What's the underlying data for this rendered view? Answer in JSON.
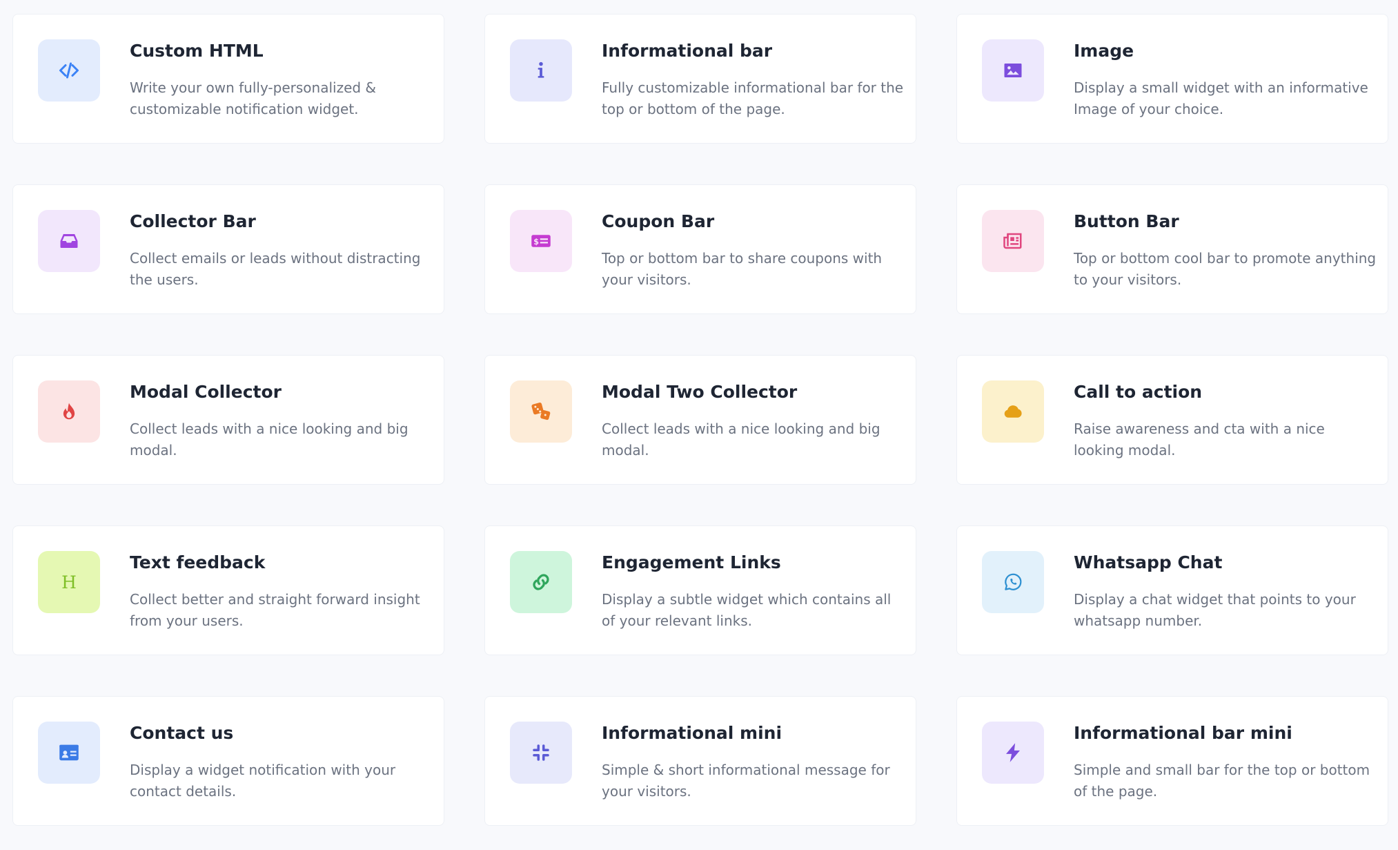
{
  "widgets": [
    {
      "title": "Custom HTML",
      "description": "Write your own fully-personalized & customizable notification widget.",
      "icon": "code-icon",
      "bg": "#e3ecfd",
      "color": "#3b82f6"
    },
    {
      "title": "Informational bar",
      "description": "Fully customizable informational bar for the top or bottom of the page.",
      "icon": "info-icon",
      "bg": "#e6e8fc",
      "color": "#5b5bd6"
    },
    {
      "title": "Image",
      "description": "Display a small widget with an informative Image of your choice.",
      "icon": "image-icon",
      "bg": "#ede8fd",
      "color": "#7c4ddd"
    },
    {
      "title": "Collector Bar",
      "description": "Collect emails or leads without distracting the users.",
      "icon": "inbox-icon",
      "bg": "#f2e7fc",
      "color": "#a044e0"
    },
    {
      "title": "Coupon Bar",
      "description": "Top or bottom bar to share coupons with your visitors.",
      "icon": "money-check-icon",
      "bg": "#f8e6f9",
      "color": "#c53bd1"
    },
    {
      "title": "Button Bar",
      "description": "Top or bottom cool bar to promote anything to your visitors.",
      "icon": "newspaper-icon",
      "bg": "#fbe5ef",
      "color": "#e0467f"
    },
    {
      "title": "Modal Collector",
      "description": "Collect leads with a nice looking and big modal.",
      "icon": "fire-icon",
      "bg": "#fce4e4",
      "color": "#e04444"
    },
    {
      "title": "Modal Two Collector",
      "description": "Collect leads with a nice looking and big modal.",
      "icon": "dice-icon",
      "bg": "#fdecd8",
      "color": "#ea7a25"
    },
    {
      "title": "Call to action",
      "description": "Raise awareness and cta with a nice looking modal.",
      "icon": "cloud-icon",
      "bg": "#fcf1cc",
      "color": "#e5a017"
    },
    {
      "title": "Text feedback",
      "description": "Collect better and straight forward insight from your users.",
      "icon": "heading-icon",
      "bg": "#e5f8b3",
      "color": "#7fbf27"
    },
    {
      "title": "Engagement Links",
      "description": "Display a subtle widget which contains all of your relevant links.",
      "icon": "link-icon",
      "bg": "#cef5dc",
      "color": "#2fa65c"
    },
    {
      "title": "Whatsapp Chat",
      "description": "Display a chat widget that points to your whatsapp number.",
      "icon": "whatsapp-icon",
      "bg": "#e2f1fb",
      "color": "#2e90d1"
    },
    {
      "title": "Contact us",
      "description": "Display a widget notification with your contact details.",
      "icon": "id-card-icon",
      "bg": "#e3ecfd",
      "color": "#3b7be6"
    },
    {
      "title": "Informational mini",
      "description": "Simple & short informational message for your visitors.",
      "icon": "compress-icon",
      "bg": "#e7e9fb",
      "color": "#5b5bd6"
    },
    {
      "title": "Informational bar mini",
      "description": "Simple and small bar for the top or bottom of the page.",
      "icon": "bolt-icon",
      "bg": "#ede8fd",
      "color": "#7c4ddd"
    }
  ]
}
